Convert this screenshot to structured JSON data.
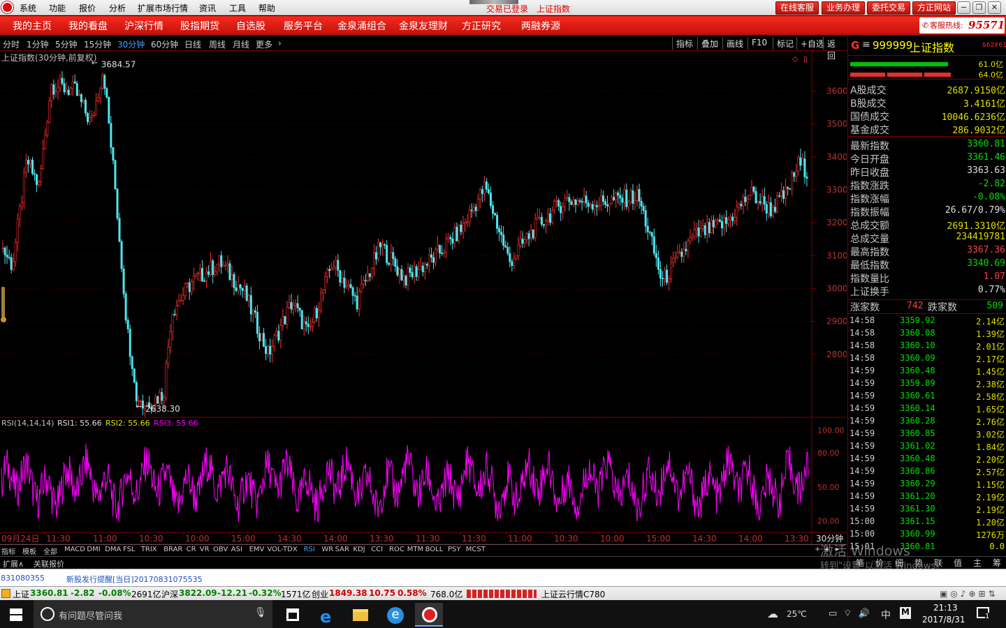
{
  "menubar": {
    "items": [
      "系统",
      "功能",
      "报价",
      "分析",
      "扩展市场行情",
      "资讯",
      "工具",
      "帮助"
    ],
    "center_login": "交易已登录",
    "center_title": "上证指数",
    "buttons": [
      "在线客服",
      "业务办理",
      "委托交易",
      "方正网站"
    ]
  },
  "navbar": {
    "items": [
      "我的主页",
      "我的看盘",
      "沪深行情",
      "股指期货",
      "自选股",
      "服务平台",
      "金泉涌组合",
      "金泉友理财",
      "方正研究",
      "两融券源"
    ],
    "hotline_label": "客服热线:",
    "hotline_number": "95571"
  },
  "toolbar": {
    "periods": [
      "分时",
      "1分钟",
      "5分钟",
      "15分钟",
      "30分钟",
      "60分钟",
      "日线",
      "周线",
      "月线",
      "更多"
    ],
    "active_index": 4,
    "more_arrow": "›",
    "tools": [
      "指标",
      "叠加",
      "画线",
      "F10",
      "标记",
      "+自选",
      "返回"
    ]
  },
  "chart_data": {
    "type": "candlestick",
    "title": "上证指数(30分钟,前复权)",
    "y_ticks": [
      3600,
      3500,
      3400,
      3300,
      3200,
      3100,
      3000,
      2900,
      2800
    ],
    "ylim": [
      2615,
      3705
    ],
    "max_label": "3684.57",
    "max_value": 3684.57,
    "max_x": 0.115,
    "min_label": "2638.30",
    "min_value": 2638.3,
    "min_x": 0.17,
    "waypoints": [
      [
        0,
        3120
      ],
      [
        0.012,
        3070
      ],
      [
        0.03,
        3390
      ],
      [
        0.045,
        3310
      ],
      [
        0.06,
        3620
      ],
      [
        0.09,
        3600
      ],
      [
        0.11,
        3500
      ],
      [
        0.125,
        3670
      ],
      [
        0.14,
        3300
      ],
      [
        0.155,
        2870
      ],
      [
        0.17,
        2640
      ],
      [
        0.2,
        2680
      ],
      [
        0.21,
        2930
      ],
      [
        0.235,
        3020
      ],
      [
        0.27,
        3080
      ],
      [
        0.3,
        2990
      ],
      [
        0.33,
        2800
      ],
      [
        0.36,
        2960
      ],
      [
        0.38,
        2860
      ],
      [
        0.41,
        3080
      ],
      [
        0.44,
        2960
      ],
      [
        0.47,
        3130
      ],
      [
        0.5,
        3030
      ],
      [
        0.535,
        3090
      ],
      [
        0.57,
        3180
      ],
      [
        0.6,
        3310
      ],
      [
        0.63,
        3080
      ],
      [
        0.66,
        3180
      ],
      [
        0.7,
        3270
      ],
      [
        0.74,
        3260
      ],
      [
        0.79,
        3280
      ],
      [
        0.8,
        3200
      ],
      [
        0.82,
        3020
      ],
      [
        0.86,
        3160
      ],
      [
        0.9,
        3200
      ],
      [
        0.93,
        3290
      ],
      [
        0.955,
        3240
      ],
      [
        0.975,
        3290
      ],
      [
        0.99,
        3380
      ],
      [
        1,
        3360
      ]
    ],
    "x_labels": [
      "09月24日",
      "11:30",
      "11:00",
      "10:30",
      "10:00",
      "15:00",
      "14:30",
      "14:00",
      "13:30",
      "11:30",
      "11:30",
      "11:00",
      "10:30",
      "10:00",
      "15:00",
      "14:30",
      "14:00",
      "13:30"
    ],
    "x_unit": "30分钟",
    "rsi": {
      "title": "RSI(14,14,14)",
      "rsi1_label": "RSI1: 55.66",
      "rsi2_label": "RSI2: 55.66",
      "rsi3_label": "RSI3: 55.66",
      "y_ticks": [
        "100.00",
        "80.00",
        "50.00",
        "20.00"
      ],
      "ylim": [
        10,
        110
      ]
    },
    "up_color": "#ff3030",
    "down_color": "#4ee6ee",
    "rsi_color": "#ff00ff"
  },
  "indicator_tabs": [
    "指标",
    "模板",
    "全部",
    "MACD",
    "DMI",
    "DMA",
    "FSL",
    "TRIX",
    "BRAR",
    "CR",
    "VR",
    "OBV",
    "ASI",
    "EMV",
    "VOL-TDX",
    "RSI",
    "WR",
    "SAR",
    "KDJ",
    "CCI",
    "ROC",
    "MTM",
    "BOLL",
    "PSY",
    "MCST"
  ],
  "indicator_active": "RSI",
  "ext_tabs": [
    "扩展∧",
    "关联报价"
  ],
  "right_panel": {
    "code": "999999",
    "name": "上证指数",
    "badge": "$62X61",
    "bar1": "61.0亿",
    "bar2": "64.0亿",
    "stats1": [
      [
        "A股成交",
        "2687.9150亿"
      ],
      [
        "B股成交",
        "3.4161亿"
      ],
      [
        "国债成交",
        "10046.6236亿"
      ],
      [
        "基金成交",
        "286.9032亿"
      ]
    ],
    "stats2": [
      [
        "最新指数",
        "3360.81",
        "#00e000"
      ],
      [
        "今日开盘",
        "3361.46",
        "#00e000"
      ],
      [
        "昨日收盘",
        "3363.63",
        "#e0e0e0"
      ],
      [
        "指数涨跌",
        "-2.82",
        "#00e000"
      ],
      [
        "指数涨幅",
        "-0.08%",
        "#00e000"
      ],
      [
        "指数振幅",
        "26.67/0.79%",
        "#e0e0e0"
      ],
      [
        "总成交额",
        "2691.3310亿",
        "#e0e000"
      ],
      [
        "总成交量",
        "234419781",
        "#e0e000"
      ],
      [
        "最高指数",
        "3367.36",
        "#ff4040"
      ],
      [
        "最低指数",
        "3340.69",
        "#00e000"
      ],
      [
        "指数量比",
        "1.07",
        "#ff4040"
      ],
      [
        "上证换手",
        "0.77%",
        "#e0e0e0"
      ]
    ],
    "up_label": "涨家数",
    "up_count": "742",
    "down_label": "跌家数",
    "down_count": "509",
    "ticks": [
      [
        "14:58",
        "3359.92",
        "2.14亿"
      ],
      [
        "14:58",
        "3360.08",
        "1.39亿"
      ],
      [
        "14:58",
        "3360.10",
        "2.01亿"
      ],
      [
        "14:58",
        "3360.09",
        "2.17亿"
      ],
      [
        "14:59",
        "3360.48",
        "1.45亿"
      ],
      [
        "14:59",
        "3359.89",
        "2.38亿"
      ],
      [
        "14:59",
        "3360.61",
        "2.58亿"
      ],
      [
        "14:59",
        "3360.14",
        "1.65亿"
      ],
      [
        "14:59",
        "3360.28",
        "2.76亿"
      ],
      [
        "14:59",
        "3360.85",
        "3.02亿"
      ],
      [
        "14:59",
        "3361.02",
        "1.84亿"
      ],
      [
        "14:59",
        "3360.48",
        "2.20亿"
      ],
      [
        "14:59",
        "3360.86",
        "2.57亿"
      ],
      [
        "14:59",
        "3360.29",
        "1.15亿"
      ],
      [
        "14:59",
        "3361.20",
        "2.19亿"
      ],
      [
        "14:59",
        "3361.30",
        "2.19亿"
      ],
      [
        "15:00",
        "3361.15",
        "1.20亿"
      ],
      [
        "15:00",
        "3360.99",
        "1276万"
      ],
      [
        "15:01",
        "3360.81",
        "0.0"
      ]
    ],
    "bottom_tabs": [
      "笔",
      "价",
      "细",
      "势",
      "联",
      "值",
      "主",
      "筹"
    ]
  },
  "watermark": {
    "line1": "激活 Windows",
    "line2": "转到\"设置\"以激活 Windows。"
  },
  "news": {
    "code": "831080355",
    "text": "新股发行提醒[当日]20170831075535"
  },
  "status": {
    "sh_label": "上证",
    "sh_value": "3360.81",
    "sh_change": "-2.82",
    "sh_pct": "-0.08%",
    "sh_amount": "2691亿",
    "sz_label": "沪深",
    "sz_value": "3822.09",
    "sz_change": "-12.21",
    "sz_pct": "-0.32%",
    "sz_amount": "1571亿",
    "cy_label": "创业",
    "cy_value": "1849.38",
    "cy_change": "10.75",
    "cy_pct": "0.58%",
    "cy_amount": "768.0亿",
    "cloud": "上证云行情C780"
  },
  "taskbar": {
    "search_placeholder": "有问题尽管问我",
    "weather": "25℃",
    "ime": "中",
    "time": "21:13",
    "date": "2017/8/31",
    "notif_count": "1"
  }
}
